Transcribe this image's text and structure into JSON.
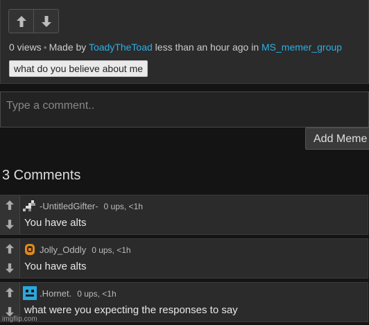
{
  "post": {
    "views": "0 views",
    "separator": "•",
    "made_by_prefix": "Made by",
    "author": "ToadyTheToad",
    "time_text": "less than an hour ago in",
    "group": "MS_memer_group",
    "tag": "what do you believe about me"
  },
  "comment_input": {
    "placeholder": "Type a comment.."
  },
  "add_meme_label": "Add Meme",
  "comments_title": "3 Comments",
  "comments": [
    {
      "user": "-UntitledGifter-",
      "meta": "0 ups, <1h",
      "text": "You have alts",
      "avatar_icon": "pixel-sprite-icon"
    },
    {
      "user": "Jolly_Oddly",
      "meta": "0 ups, <1h",
      "text": "You have alts",
      "avatar_icon": "orange-face-icon"
    },
    {
      "user": ".Hornet.",
      "meta": "0 ups, <1h",
      "text": "what were you expecting the responses to say",
      "avatar_icon": "blue-robot-icon"
    }
  ],
  "watermark": "imgflip.com",
  "colors": {
    "link": "#2bb0e6",
    "background": "#141414",
    "panel": "#2b2b2b"
  }
}
